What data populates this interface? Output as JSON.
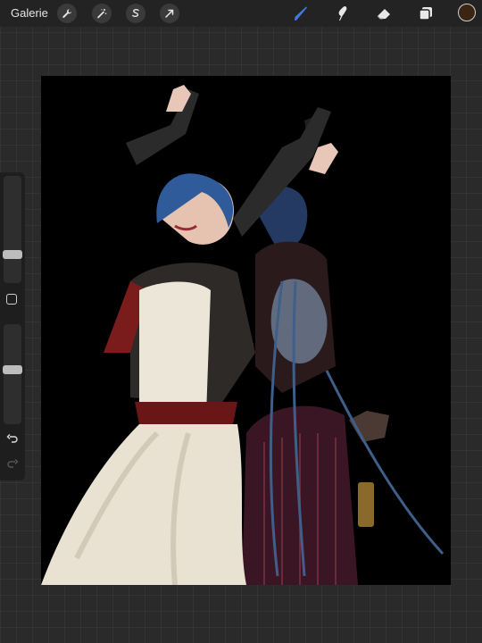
{
  "topbar": {
    "gallery_label": "Galerie",
    "tools_left": [
      {
        "name": "actions",
        "icon": "wrench-icon"
      },
      {
        "name": "adjustments",
        "icon": "magic-wand-icon"
      },
      {
        "name": "selection",
        "icon": "selection-s-icon"
      },
      {
        "name": "transform",
        "icon": "arrow-cursor-icon"
      }
    ],
    "tools_right": [
      {
        "name": "brush",
        "icon": "brush-icon",
        "active": true
      },
      {
        "name": "smudge",
        "icon": "smudge-icon"
      },
      {
        "name": "eraser",
        "icon": "eraser-icon"
      },
      {
        "name": "layers",
        "icon": "layers-icon"
      }
    ],
    "active_color": "#3a2412",
    "accent_color": "#3d7be0"
  },
  "sidebar": {
    "brush_size_level": 0.25,
    "opacity_level": 0.55,
    "modify_icon": "square-icon",
    "undo_icon": "undo-icon",
    "redo_icon": "redo-icon"
  },
  "canvas": {
    "background_color": "#000000",
    "description_icon": "artwork-image"
  }
}
